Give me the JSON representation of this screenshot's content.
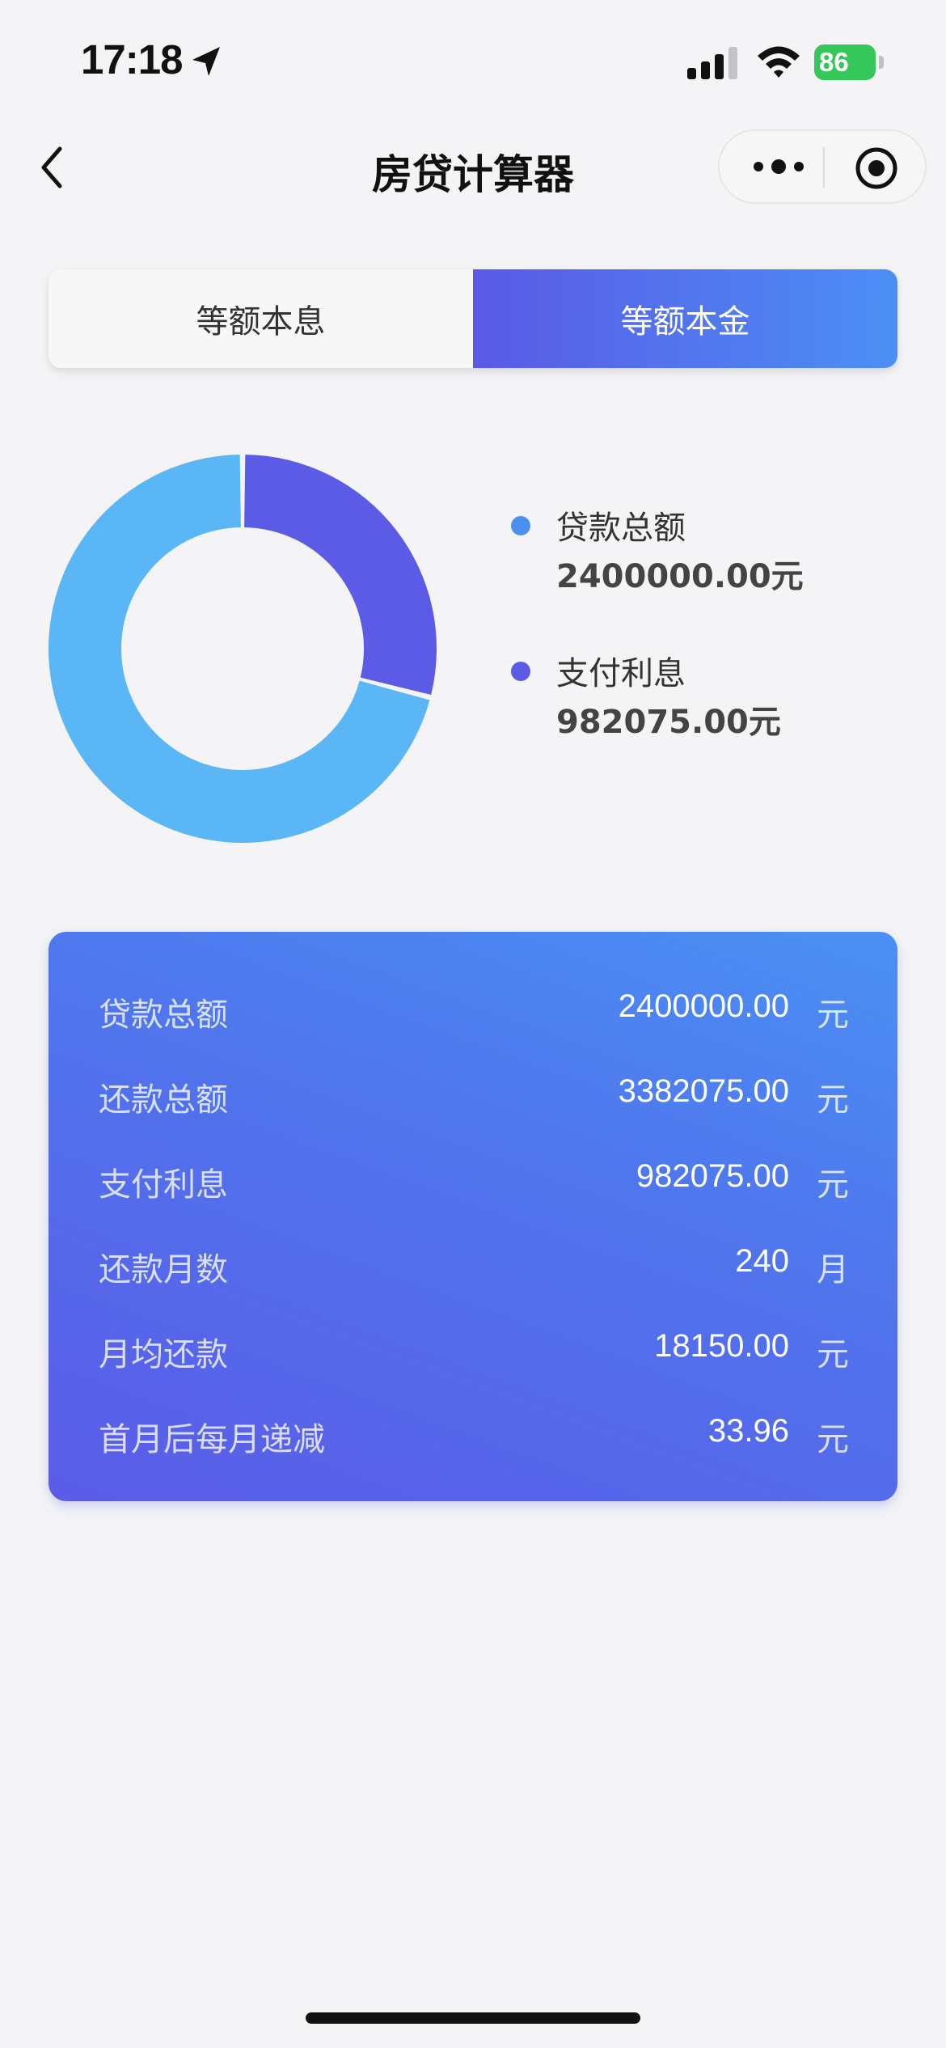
{
  "status_bar": {
    "time": "17:18",
    "battery": "86",
    "battery_color": "#35c759"
  },
  "navbar": {
    "title": "房贷计算器",
    "back_icon": "chevron-left-icon",
    "more_icon": "more-dots-icon",
    "target_icon": "record-target-icon"
  },
  "tabs": [
    {
      "label": "等额本息",
      "active": false
    },
    {
      "label": "等额本金",
      "active": true
    }
  ],
  "chart_data": {
    "type": "pie",
    "categories": [
      "贷款总额",
      "支付利息"
    ],
    "values": [
      2400000.0,
      982075.0
    ],
    "colors": [
      "#5bb6f5",
      "#5b5be6"
    ],
    "legend_dot_colors": [
      "#4a90f0",
      "#5b5be6"
    ],
    "unit": "元"
  },
  "legend": [
    {
      "name": "贷款总额",
      "value": "2400000.00元"
    },
    {
      "name": "支付利息",
      "value": "982075.00元"
    }
  ],
  "summary": {
    "rows": [
      {
        "label": "贷款总额",
        "value": "2400000.00",
        "unit": "元"
      },
      {
        "label": "还款总额",
        "value": "3382075.00",
        "unit": "元"
      },
      {
        "label": "支付利息",
        "value": "982075.00",
        "unit": "元"
      },
      {
        "label": "还款月数",
        "value": "240",
        "unit": "月"
      },
      {
        "label": "月均还款",
        "value": "18150.00",
        "unit": "元"
      },
      {
        "label": "首月后每月递减",
        "value": "33.96",
        "unit": "元"
      }
    ]
  },
  "colors": {
    "accent_start": "#5a5ae6",
    "accent_end": "#4b8ff5",
    "background": "#f4f4f6"
  }
}
